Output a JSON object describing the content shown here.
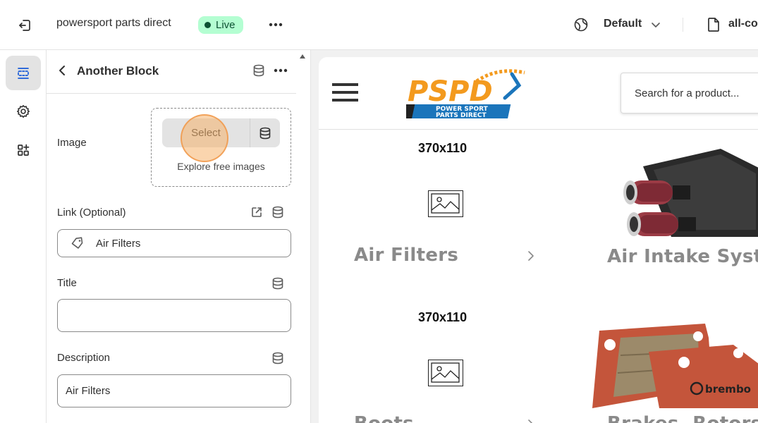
{
  "topbar": {
    "store_name": "powersport parts direct",
    "status_badge": "Live",
    "theme_selector": "Default",
    "page_selector": "all-co"
  },
  "panel": {
    "title": "Another Block",
    "image": {
      "label": "Image",
      "select_label": "Select",
      "explore_label": "Explore free images"
    },
    "link": {
      "label": "Link (Optional)",
      "value": "Air Filters"
    },
    "title_field": {
      "label": "Title",
      "value": ""
    },
    "description": {
      "label": "Description",
      "value": "Air Filters"
    }
  },
  "preview": {
    "search_placeholder": "Search for a product...",
    "logo_text": "PSPD",
    "logo_subtext_1": "POWER SPORT",
    "logo_subtext_2": "PARTS DIRECT",
    "blocks": [
      {
        "size_label": "370x110",
        "name": "Air Filters"
      },
      {
        "size_label": "370x110",
        "name": "Boots"
      }
    ],
    "products": [
      {
        "name": "Air Intake System"
      },
      {
        "name": "Brakes, Rotors & I"
      }
    ]
  },
  "colors": {
    "live_badge_bg": "#b4fed2",
    "live_badge_text": "#0c5132",
    "click_highlight": "#f6b26b",
    "logo_orange": "#f39a1e",
    "logo_blue": "#1b75bb"
  }
}
